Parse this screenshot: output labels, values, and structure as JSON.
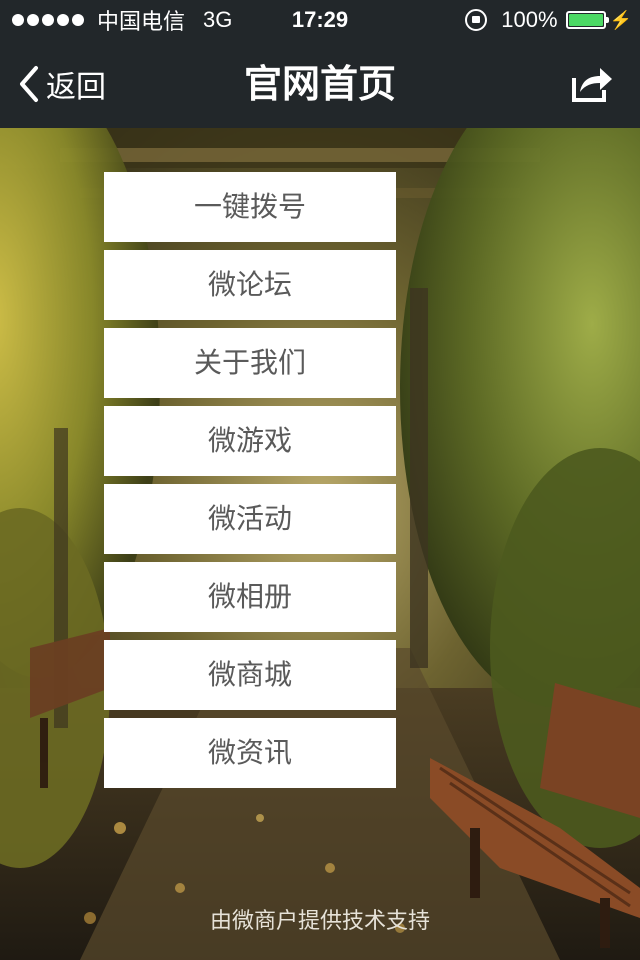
{
  "status_bar": {
    "carrier": "中国电信",
    "network": "3G",
    "time": "17:29",
    "battery": "100%",
    "battery_color": "#4cd964"
  },
  "nav": {
    "back_label": "返回",
    "title": "官网首页",
    "share_icon": "share-icon"
  },
  "menu": {
    "items": [
      {
        "label": "一键拨号"
      },
      {
        "label": "微论坛"
      },
      {
        "label": "关于我们"
      },
      {
        "label": "微游戏"
      },
      {
        "label": "微活动"
      },
      {
        "label": "微相册"
      },
      {
        "label": "微商城"
      },
      {
        "label": "微资讯"
      }
    ]
  },
  "footer": {
    "text": "由微商户提供技术支持"
  },
  "colors": {
    "bar_background": "#22272a",
    "menu_background": "#ffffff",
    "menu_text": "#5a5a5a"
  }
}
